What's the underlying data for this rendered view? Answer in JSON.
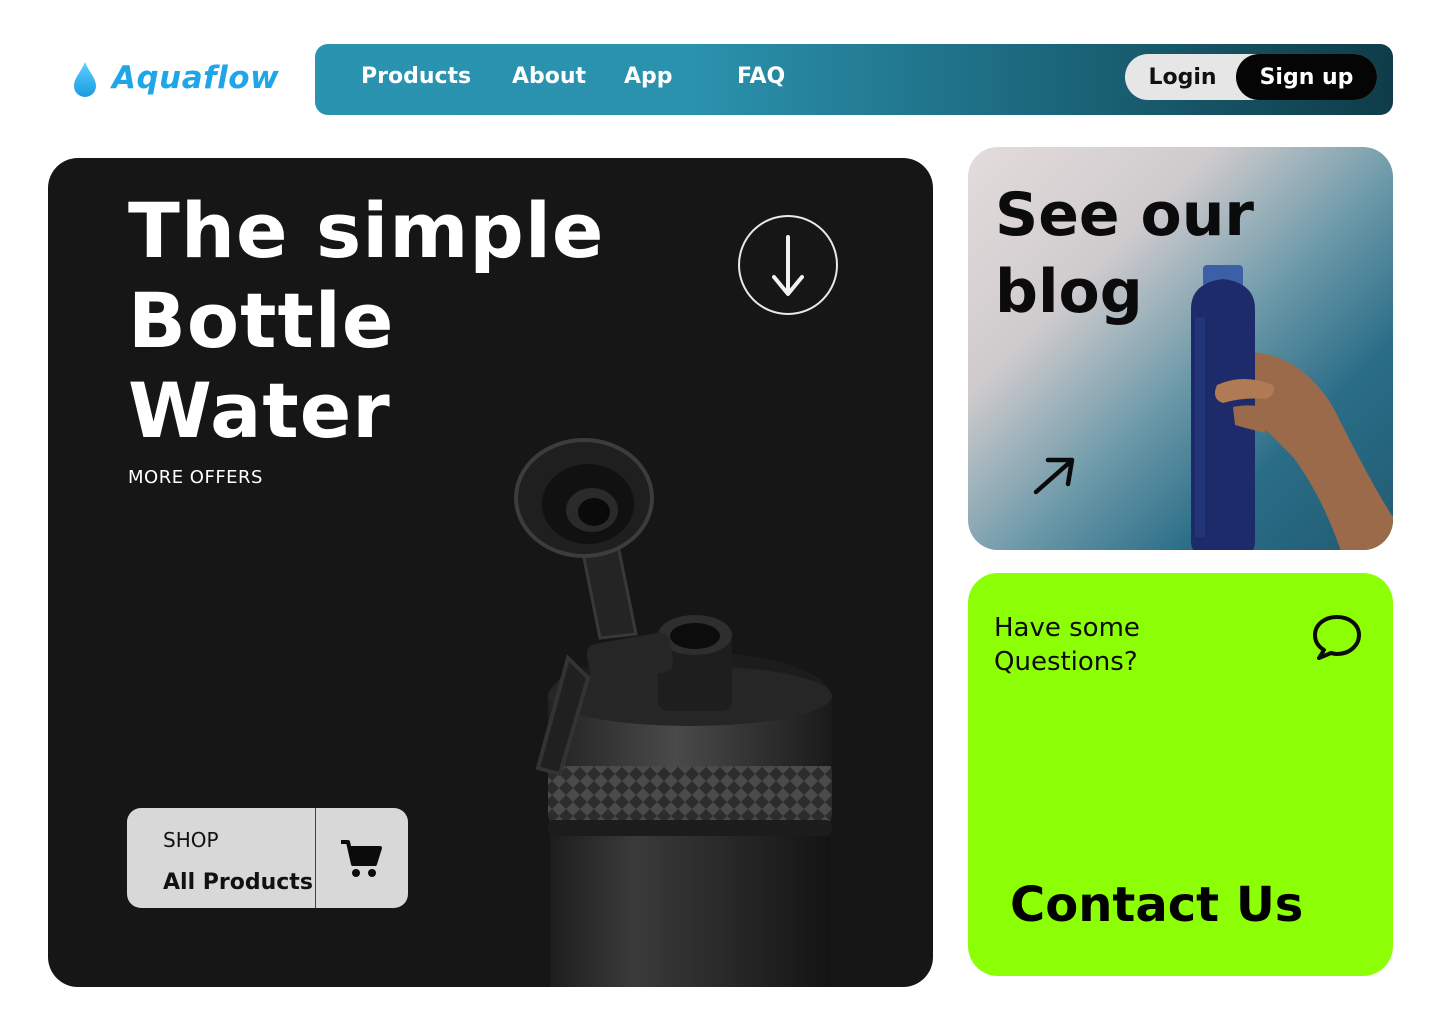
{
  "brand": {
    "name": "Aquaflow",
    "icon": "water-drop-icon",
    "color": "#1fa6e6"
  },
  "nav": {
    "links": [
      "Products",
      "About",
      "App",
      "FAQ"
    ],
    "login_label": "Login",
    "signup_label": "Sign up",
    "gradient": [
      "#2b92ae",
      "#0f3c48"
    ]
  },
  "hero": {
    "title_lines": [
      "The simple",
      "Bottle",
      "Water"
    ],
    "more_offers": "MORE OFFERS",
    "scroll_icon": "arrow-down-icon",
    "shop": {
      "label": "SHOP",
      "sub_label": "All Products",
      "icon": "shopping-cart-icon"
    },
    "background": "#161616"
  },
  "blog": {
    "title_lines": [
      "See our",
      "blog"
    ],
    "icon": "arrow-up-right-icon"
  },
  "contact": {
    "question_lines": [
      "Have some",
      "Questions?"
    ],
    "cta": "Contact Us",
    "icon": "chat-bubble-icon",
    "background": "#8cff06"
  }
}
